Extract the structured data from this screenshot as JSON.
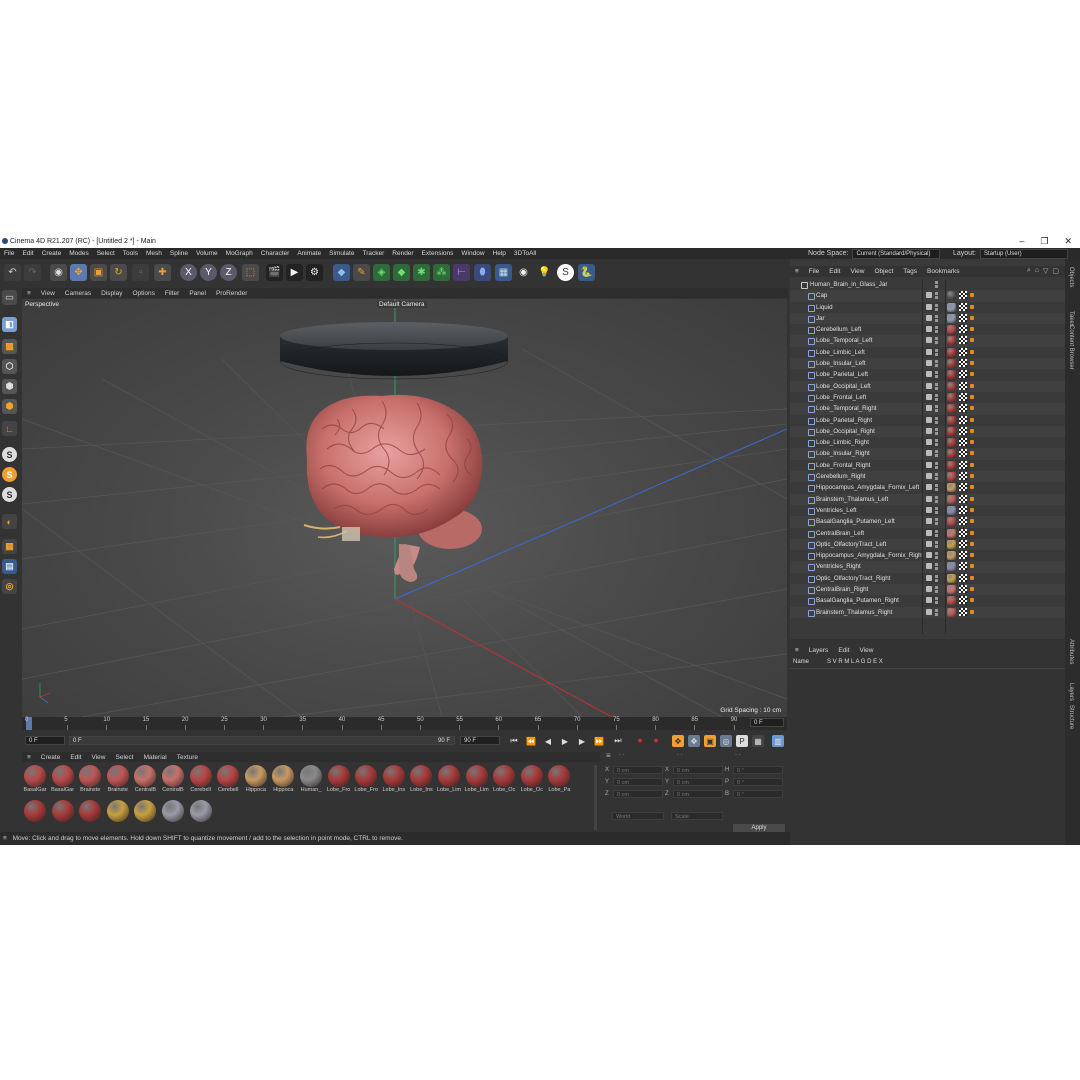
{
  "window": {
    "title": "Cinema 4D R21.207 (RC) - [Untitled 2 *] - Main",
    "controls": [
      "–",
      "❐",
      "✕"
    ]
  },
  "menu": [
    "File",
    "Edit",
    "Create",
    "Modes",
    "Select",
    "Tools",
    "Mesh",
    "Spline",
    "Volume",
    "MoGraph",
    "Character",
    "Animate",
    "Simulate",
    "Tracker",
    "Render",
    "Extensions",
    "Window",
    "Help",
    "3DToAll"
  ],
  "node_space": {
    "label": "Node Space:",
    "value": "Current (Standard/Physical)"
  },
  "layout": {
    "label": "Layout:",
    "value": "Startup (User)"
  },
  "viewport": {
    "menu": [
      "View",
      "Cameras",
      "Display",
      "Options",
      "Filter",
      "Panel",
      "ProRender"
    ],
    "view_name": "Perspective",
    "camera": "Default Camera",
    "grid_spacing": "Grid Spacing : 10 cm"
  },
  "timeline": {
    "ticks": [
      "0",
      "5",
      "10",
      "15",
      "20",
      "25",
      "30",
      "35",
      "40",
      "45",
      "50",
      "55",
      "60",
      "65",
      "70",
      "75",
      "80",
      "85",
      "90"
    ],
    "current_frame": "0 F",
    "start": "0 F",
    "start2": "0 F",
    "end": "90 F",
    "end2": "90 F",
    "end3": "90 F"
  },
  "material_menu": [
    "Create",
    "Edit",
    "View",
    "Select",
    "Material",
    "Texture"
  ],
  "materials": [
    {
      "label": "BasalGar",
      "color": "#b84a4a"
    },
    {
      "label": "BasalGar",
      "color": "#b84a4a"
    },
    {
      "label": "Brainste",
      "color": "#c05555"
    },
    {
      "label": "Brainste",
      "color": "#c05555"
    },
    {
      "label": "CentralB",
      "color": "#c8706a"
    },
    {
      "label": "CentralB",
      "color": "#c8706a"
    },
    {
      "label": "Cerebell",
      "color": "#b84545"
    },
    {
      "label": "Cerebell",
      "color": "#b84545"
    },
    {
      "label": "Hippoca",
      "color": "#c89a60"
    },
    {
      "label": "Hippoca",
      "color": "#c89a60"
    },
    {
      "label": "Human_",
      "color": "#8a8a8a"
    },
    {
      "label": "Lobe_Fro",
      "color": "#a83a3a"
    },
    {
      "label": "Lobe_Fro",
      "color": "#a83a3a"
    },
    {
      "label": "Lobe_Ins",
      "color": "#a83a3a"
    },
    {
      "label": "Lobe_Ins",
      "color": "#a83a3a"
    },
    {
      "label": "Lobe_Lim",
      "color": "#a83a3a"
    },
    {
      "label": "Lobe_Lim",
      "color": "#a83a3a"
    },
    {
      "label": "Lobe_Oc",
      "color": "#a83a3a"
    },
    {
      "label": "Lobe_Oc",
      "color": "#a83a3a"
    },
    {
      "label": "Lobe_Pa",
      "color": "#a83a3a"
    },
    {
      "label": "",
      "color": "#a83a3a"
    },
    {
      "label": "",
      "color": "#a83a3a"
    },
    {
      "label": "",
      "color": "#a83a3a"
    },
    {
      "label": "",
      "color": "#c8a040"
    },
    {
      "label": "",
      "color": "#c8a040"
    },
    {
      "label": "",
      "color": "#9a9aa8"
    },
    {
      "label": "",
      "color": "#9a9aa8"
    }
  ],
  "coords": {
    "rows": [
      {
        "a": "X",
        "av": "0 cm",
        "b": "X",
        "bv": "0 cm",
        "c": "H",
        "cv": "0 °"
      },
      {
        "a": "Y",
        "av": "0 cm",
        "b": "Y",
        "bv": "0 cm",
        "c": "P",
        "cv": "0 °"
      },
      {
        "a": "Z",
        "av": "0 cm",
        "b": "Z",
        "bv": "0 cm",
        "c": "B",
        "cv": "0 °"
      }
    ],
    "mode1": "World",
    "mode2": "Scale",
    "apply": "Apply"
  },
  "status": "Move: Click and drag to move elements. Hold down SHIFT to quantize movement / add to the selection in point mode, CTRL to remove.",
  "objects_menu": [
    "File",
    "Edit",
    "View",
    "Object",
    "Tags",
    "Bookmarks"
  ],
  "objects": [
    {
      "name": "Human_Brain_in_Glass_Jar",
      "tag": "#777777",
      "root": true
    },
    {
      "name": "Cap",
      "tag": "#555555"
    },
    {
      "name": "Liquid",
      "tag": "#8aa0b0"
    },
    {
      "name": "Jar",
      "tag": "#8a9aa8"
    },
    {
      "name": "Cerebellum_Left",
      "tag": "#b84545"
    },
    {
      "name": "Lobe_Temporal_Left",
      "tag": "#a83a3a"
    },
    {
      "name": "Lobe_Limbic_Left",
      "tag": "#a83a3a"
    },
    {
      "name": "Lobe_Insular_Left",
      "tag": "#a83a3a"
    },
    {
      "name": "Lobe_Parietal_Left",
      "tag": "#a83a3a"
    },
    {
      "name": "Lobe_Occipital_Left",
      "tag": "#a83a3a"
    },
    {
      "name": "Lobe_Frontal_Left",
      "tag": "#a83a3a"
    },
    {
      "name": "Lobe_Temporal_Right",
      "tag": "#a83a3a"
    },
    {
      "name": "Lobe_Parietal_Right",
      "tag": "#a83a3a"
    },
    {
      "name": "Lobe_Occipital_Right",
      "tag": "#a83a3a"
    },
    {
      "name": "Lobe_Limbic_Right",
      "tag": "#a83a3a"
    },
    {
      "name": "Lobe_Insular_Right",
      "tag": "#a83a3a"
    },
    {
      "name": "Lobe_Frontal_Right",
      "tag": "#a83a3a"
    },
    {
      "name": "Cerebellum_Right",
      "tag": "#b84545"
    },
    {
      "name": "Hippocampus_Amygdala_Fornix_Left",
      "tag": "#c89a60"
    },
    {
      "name": "Brainstem_Thalamus_Left",
      "tag": "#c05555"
    },
    {
      "name": "Ventricles_Left",
      "tag": "#8a8ab0"
    },
    {
      "name": "BasalGanglia_Putamen_Left",
      "tag": "#b84a4a"
    },
    {
      "name": "CentralBrain_Left",
      "tag": "#c8706a"
    },
    {
      "name": "Optic_OlfactoryTract_Left",
      "tag": "#c8a040"
    },
    {
      "name": "Hippocampus_Amygdala_Fornix_Right",
      "tag": "#c89a60"
    },
    {
      "name": "Ventricles_Right",
      "tag": "#8a8ab0"
    },
    {
      "name": "Optic_OlfactoryTract_Right",
      "tag": "#c8a040"
    },
    {
      "name": "CentralBrain_Right",
      "tag": "#c8706a"
    },
    {
      "name": "BasalGanglia_Putamen_Right",
      "tag": "#b84a4a"
    },
    {
      "name": "Brainstem_Thalamus_Right",
      "tag": "#c05555"
    }
  ],
  "layers_menu": [
    "Layers",
    "Edit",
    "View"
  ],
  "layers_header": {
    "name": "Name",
    "flags": "S V R M L A G D E X"
  },
  "side_tabs": [
    "Objects",
    "Takes",
    "Content Browser",
    "Attributes",
    "Layers",
    "Structure"
  ],
  "accent": "#f0a030"
}
